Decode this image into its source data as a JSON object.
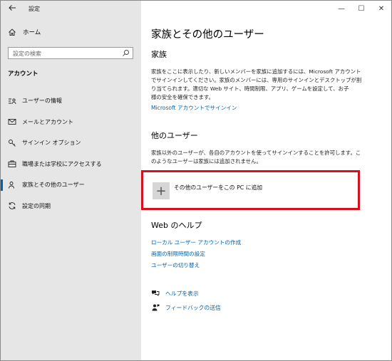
{
  "window": {
    "app_title": "設定",
    "controls": {
      "minimize": "—",
      "maximize": "☐",
      "close": "✕"
    }
  },
  "sidebar": {
    "home_label": "ホーム",
    "search_placeholder": "設定の検索",
    "section_header": "アカウント",
    "items": [
      {
        "label": "ユーザーの情報",
        "icon": "user-info-icon"
      },
      {
        "label": "メールとアカウント",
        "icon": "mail-icon"
      },
      {
        "label": "サインイン オプション",
        "icon": "key-icon"
      },
      {
        "label": "職場または学校にアクセスする",
        "icon": "briefcase-icon"
      },
      {
        "label": "家族とその他のユーザー",
        "icon": "family-icon",
        "selected": true
      },
      {
        "label": "設定の同期",
        "icon": "sync-icon"
      }
    ]
  },
  "main": {
    "title": "家族とその他のユーザー",
    "family": {
      "heading": "家族",
      "description_lines": [
        "家族をここに表示したり、新しいメンバーを家族に追加するには、Microsoft アカウント",
        "でサインインしてください。家族のメンバーには、専用のサインインとデスクトップが割",
        "り当てられます。適切な Web サイト、時間制限、アプリ、ゲームを設定して、お子",
        "様の安全を確保できます。"
      ],
      "signin_link": "Microsoft アカウントでサインイン"
    },
    "other_users": {
      "heading": "他のユーザー",
      "description_lines": [
        "家族以外のユーザーが、各自のアカウントを使ってサインインすることを許可します。こ",
        "のようなユーザーは家族には追加されません。"
      ],
      "add_button_label": "その他のユーザーをこの PC に追加",
      "add_button_symbol": "+"
    },
    "web_help": {
      "heading": "Web のヘルプ",
      "links": [
        "ローカル ユーザー アカウントの作成",
        "画面の制限時間の設定",
        "ユーザーの切り替え"
      ]
    },
    "help_links": {
      "get_help": "ヘルプを表示",
      "feedback": "フィードバックの送信"
    }
  },
  "colors": {
    "accent": "#0063b1",
    "highlight_border": "#d7101f",
    "sidebar_bg": "#e6e6e6"
  }
}
